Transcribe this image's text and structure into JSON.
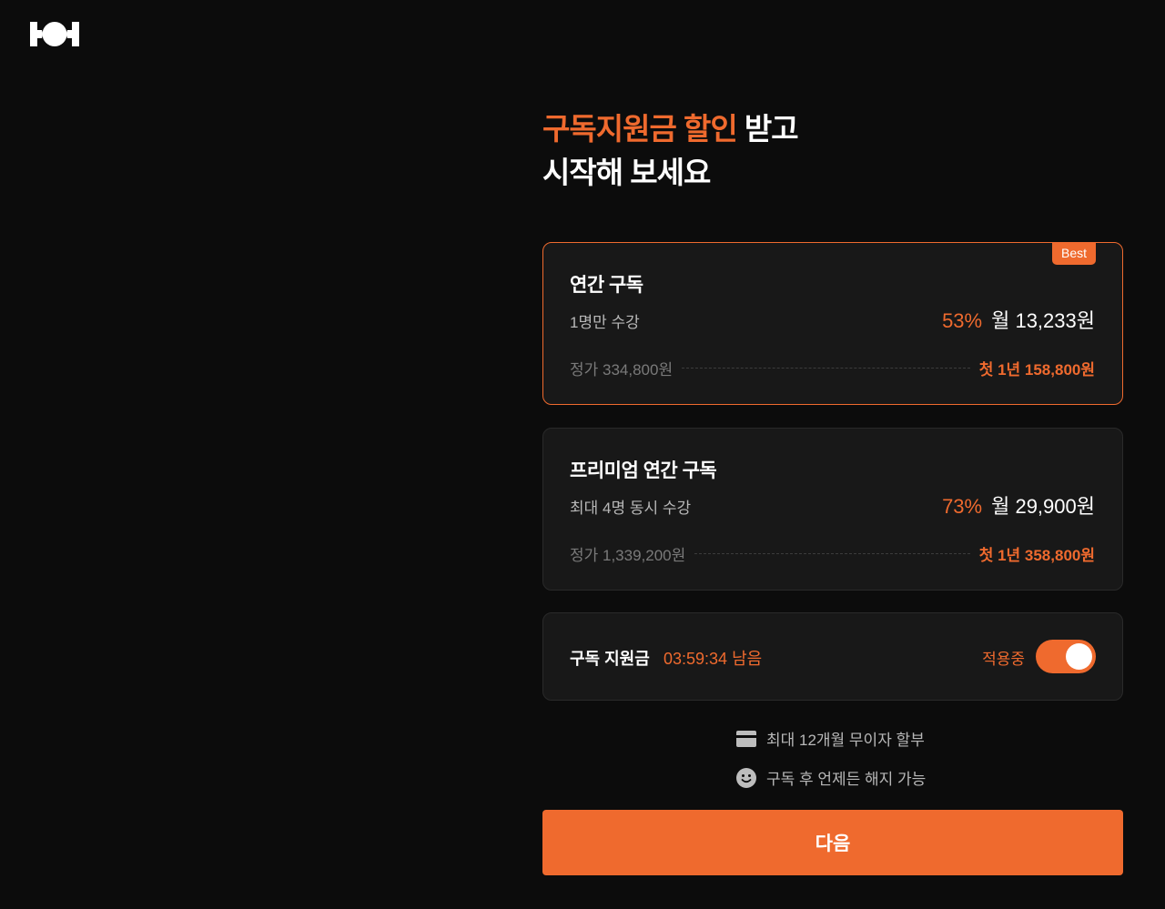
{
  "logo": {
    "icon": "brand-logo-icon"
  },
  "headline": {
    "accent": "구독지원금 할인",
    "rest": " 받고",
    "line2": "시작해 보세요"
  },
  "plans": [
    {
      "title": "연간 구독",
      "subtitle": "1명만 수강",
      "badge": "Best",
      "discount": "53%",
      "monthly": "월 13,233원",
      "regular": "정가 334,800원",
      "first_year": "첫 1년 158,800원",
      "selected": true
    },
    {
      "title": "프리미엄 연간 구독",
      "subtitle": "최대 4명 동시 수강",
      "discount": "73%",
      "monthly": "월 29,900원",
      "regular": "정가 1,339,200원",
      "first_year": "첫 1년 358,800원",
      "selected": false
    }
  ],
  "subsidy": {
    "label": "구독 지원금",
    "timer": "03:59:34 남음",
    "status": "적용중",
    "toggle_on": true
  },
  "benefits": [
    {
      "icon": "credit-card-icon",
      "text": "최대 12개월 무이자 할부"
    },
    {
      "icon": "smile-icon",
      "text": "구독 후 언제든 해지 가능"
    }
  ],
  "cta": {
    "label": "다음"
  },
  "colors": {
    "accent": "#ef6a2e",
    "background": "#0c0c0c",
    "card": "#181818"
  }
}
